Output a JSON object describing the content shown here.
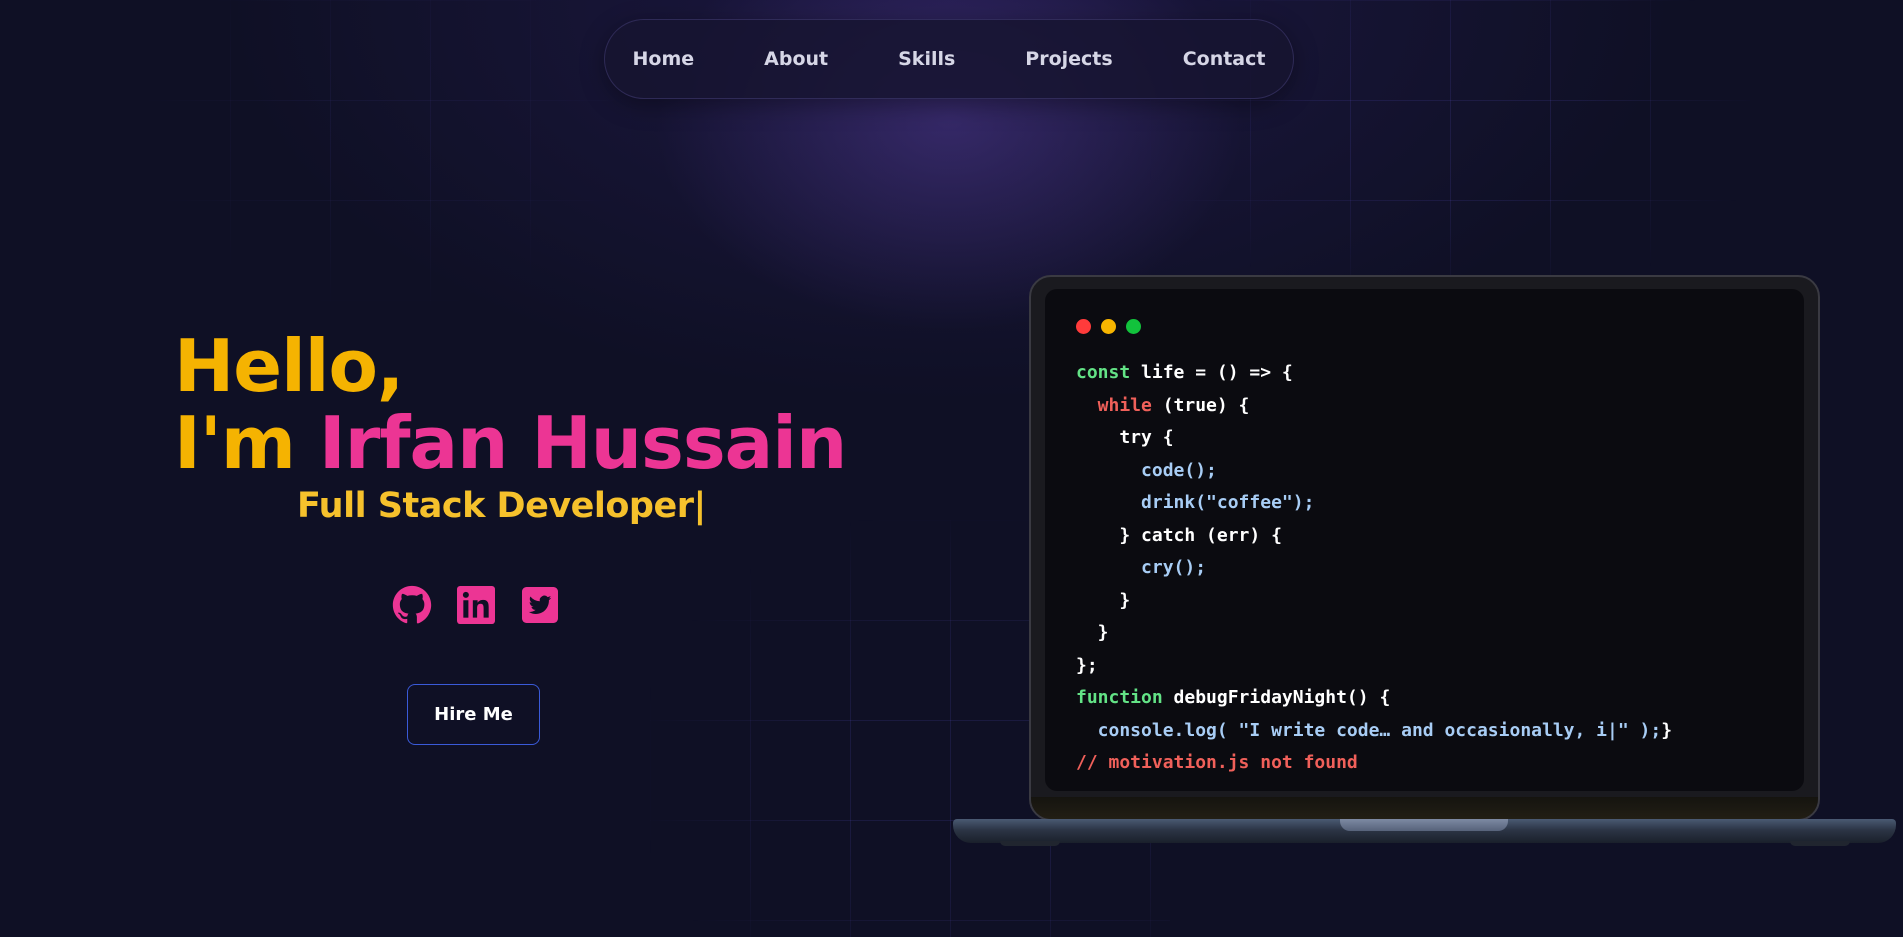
{
  "nav": {
    "items": [
      {
        "label": "Home"
      },
      {
        "label": "About"
      },
      {
        "label": "Skills"
      },
      {
        "label": "Projects"
      },
      {
        "label": "Contact"
      }
    ]
  },
  "hero": {
    "greeting": "Hello,",
    "intro": "I'm ",
    "name": "Irfan Hussain",
    "role": "Full Stack Developer|",
    "hire_label": "Hire Me",
    "socials": [
      {
        "icon": "github-icon"
      },
      {
        "icon": "linkedin-icon"
      },
      {
        "icon": "twitter-icon"
      }
    ]
  },
  "colors": {
    "accent_yellow": "#f5b301",
    "accent_pink": "#ec3594",
    "button_border": "#3a5ad8",
    "dot_red": "#ff3b3b",
    "dot_yellow": "#f7b500",
    "dot_green": "#12c23c"
  },
  "code": {
    "lines": [
      [
        {
          "t": "const",
          "c": "c-green"
        },
        {
          "t": " life = () => {",
          "c": "c-white"
        }
      ],
      [
        {
          "t": "  while",
          "c": "c-red"
        },
        {
          "t": " (true) {",
          "c": "c-white"
        }
      ],
      [
        {
          "t": "    try {",
          "c": "c-white"
        }
      ],
      [
        {
          "t": "      code();",
          "c": "c-blue"
        }
      ],
      [
        {
          "t": "      drink(\"coffee\");",
          "c": "c-blue"
        }
      ],
      [
        {
          "t": "    } catch (err) {",
          "c": "c-white"
        }
      ],
      [
        {
          "t": "      cry();",
          "c": "c-blue"
        }
      ],
      [
        {
          "t": "    }",
          "c": "c-white"
        }
      ],
      [
        {
          "t": "  }",
          "c": "c-white"
        }
      ],
      [
        {
          "t": "};",
          "c": "c-white"
        }
      ],
      [
        {
          "t": "function",
          "c": "c-green"
        },
        {
          "t": " debugFridayNight() {",
          "c": "c-white"
        }
      ],
      [
        {
          "t": "  console.log( \"I write code… and occasionally, i|\" );",
          "c": "c-blue"
        },
        {
          "t": "}",
          "c": "c-white"
        }
      ],
      [
        {
          "t": "// motivation.js not found",
          "c": "c-red"
        }
      ]
    ]
  }
}
